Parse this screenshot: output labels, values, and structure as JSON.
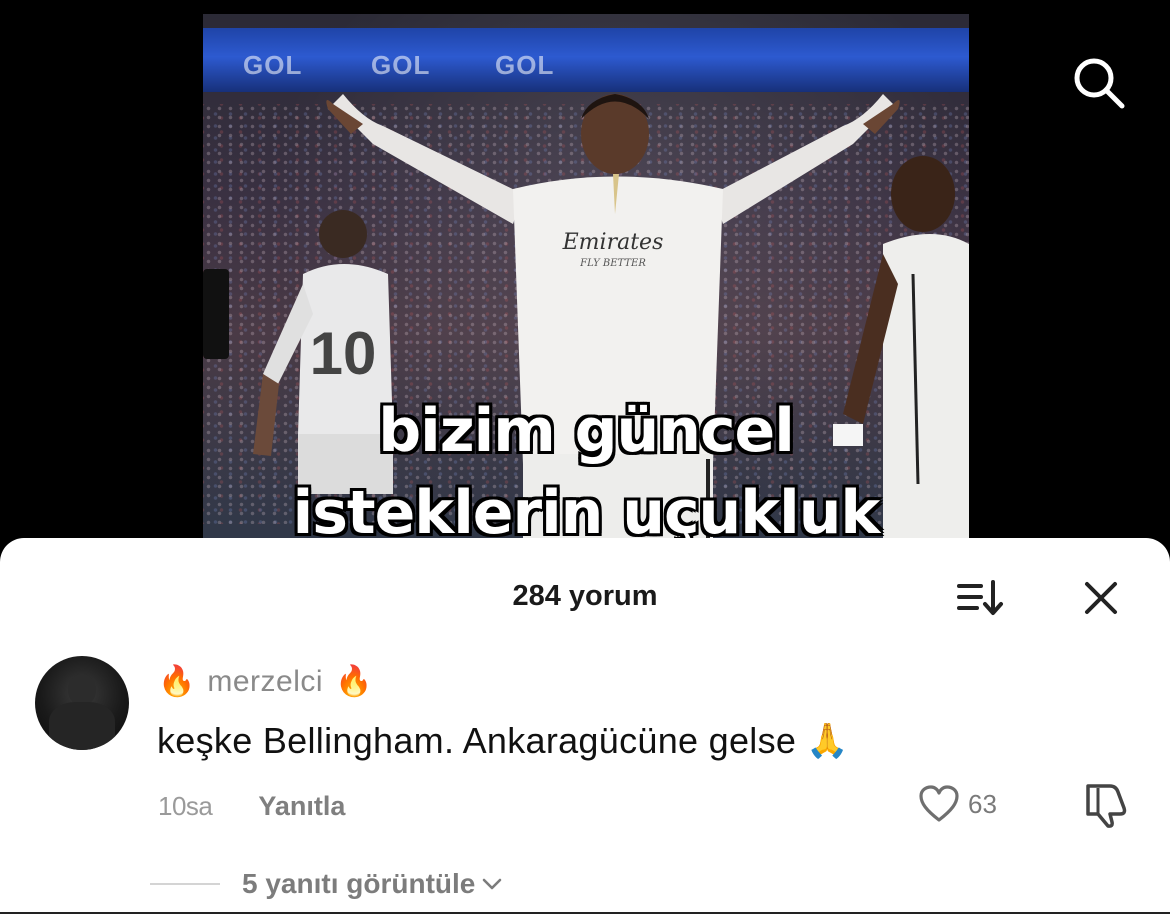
{
  "video": {
    "caption_line1": "bizim güncel",
    "caption_line2": "isteklerin uçukluk",
    "led_text": "GOL",
    "jersey_sponsor": "Emirates",
    "jersey_sponsor_sub": "FLY BETTER",
    "player_number": "10"
  },
  "header": {
    "search_icon": "search-icon"
  },
  "comments": {
    "count_label": "284 yorum",
    "sort_icon": "sort-icon",
    "close_icon": "close-icon",
    "items": [
      {
        "username": "merzelci",
        "badge_left": "🔥",
        "badge_right": "🔥",
        "text": "keşke Bellingham. Ankaragücüne gelse",
        "emoji": "🙏",
        "time": "10sa",
        "reply_label": "Yanıtla",
        "likes": "63",
        "view_replies": "5 yanıtı görüntüle"
      }
    ]
  },
  "colors": {
    "sheet_bg": "#ffffff",
    "muted_text": "#8a8a8a",
    "primary_text": "#111111"
  }
}
